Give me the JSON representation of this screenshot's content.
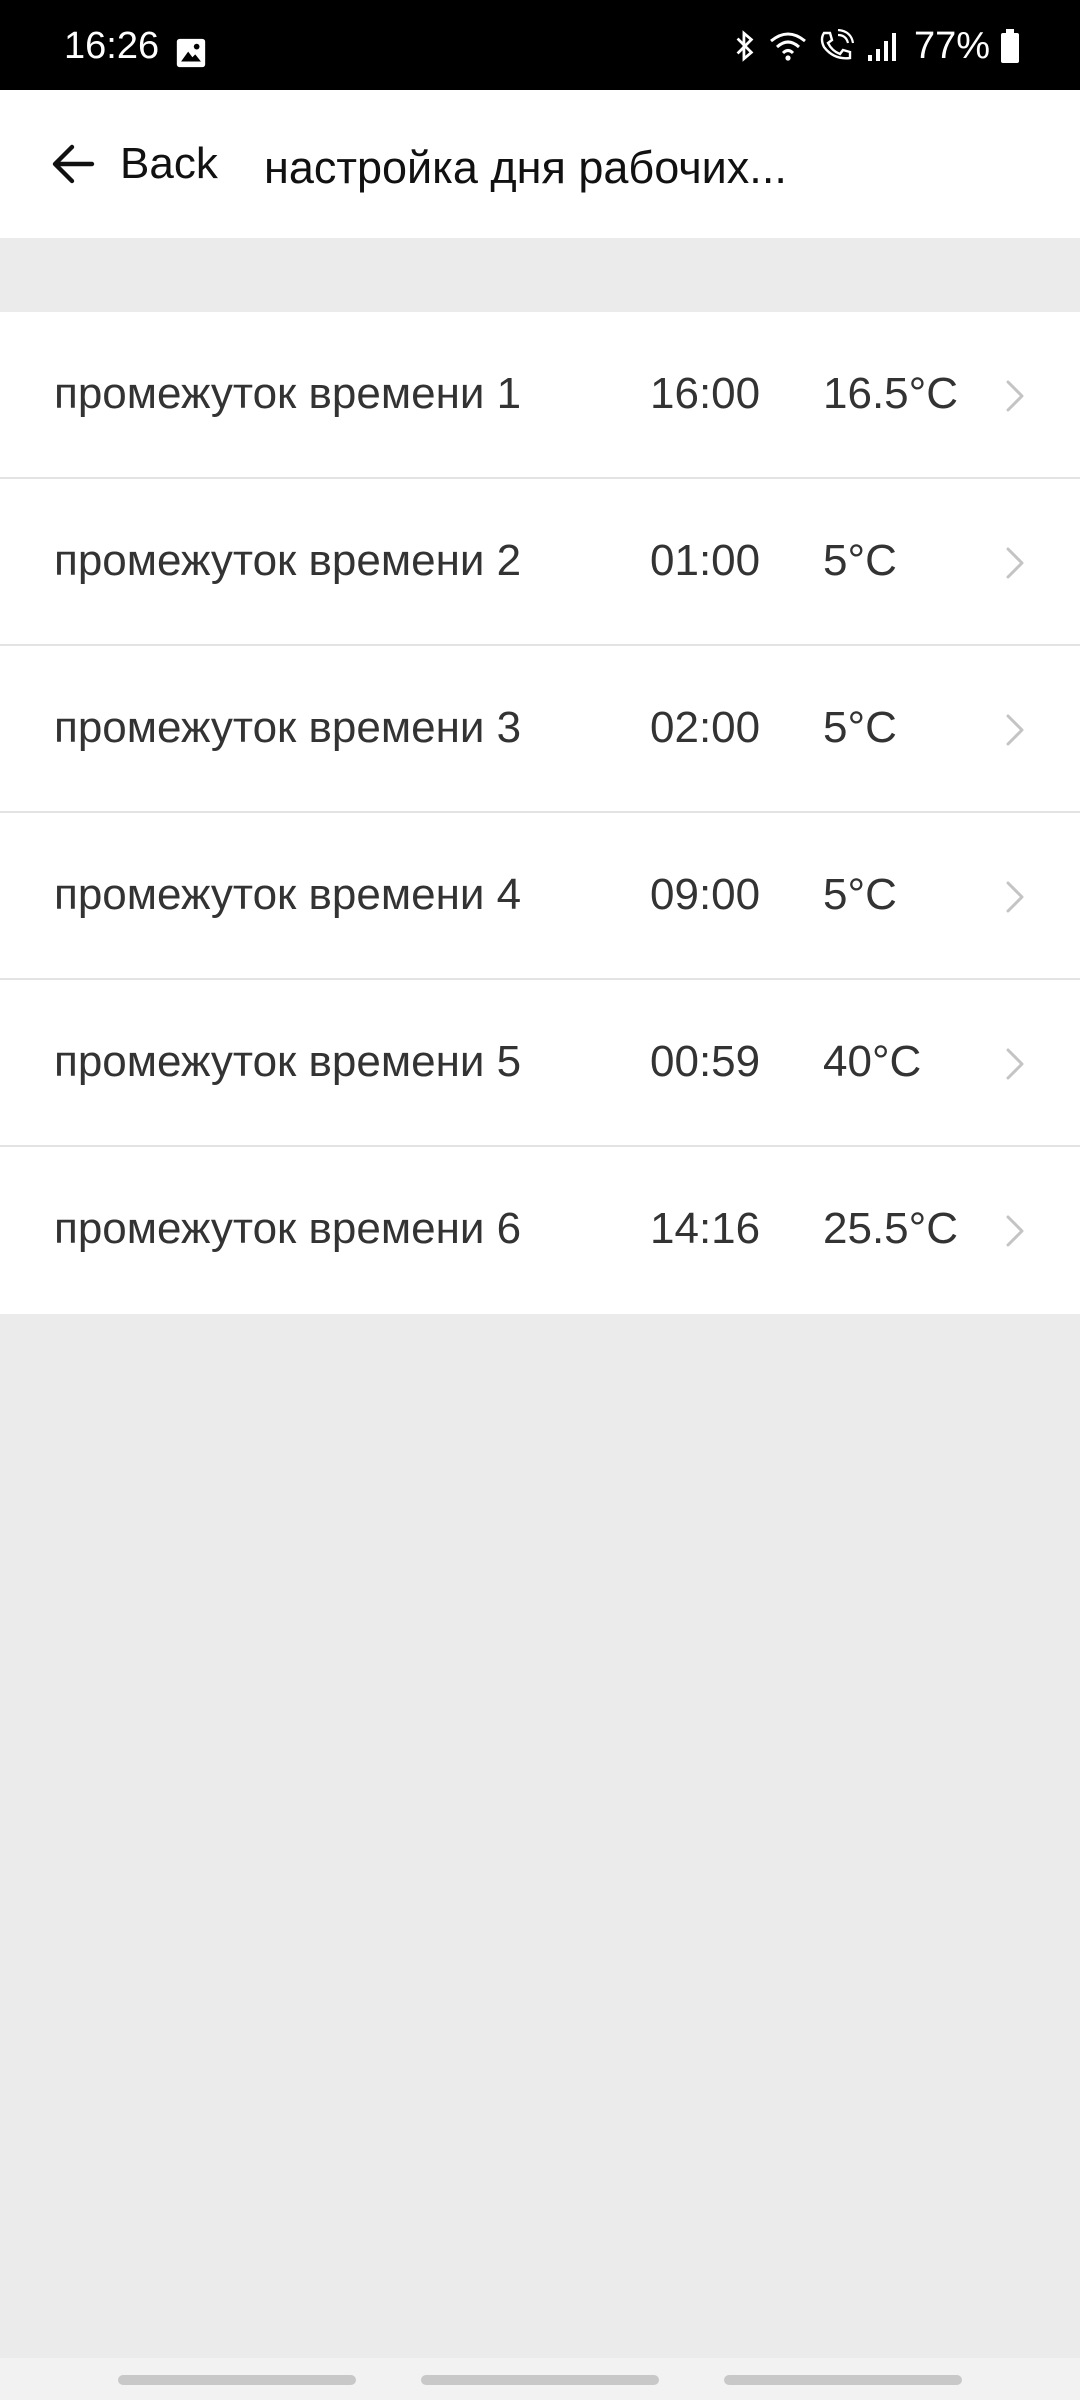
{
  "status_bar": {
    "time": "16:26",
    "battery": "77%",
    "icons": [
      "image-icon",
      "bluetooth-icon",
      "wifi-icon",
      "volte-call-icon",
      "signal-icon",
      "battery-icon"
    ]
  },
  "header": {
    "back_label": "Back",
    "title": "настройка дня рабочих..."
  },
  "periods": [
    {
      "label": "промежуток времени 1",
      "time": "16:00",
      "temp": "16.5°C"
    },
    {
      "label": "промежуток времени 2",
      "time": "01:00",
      "temp": "5°C"
    },
    {
      "label": "промежуток времени 3",
      "time": "02:00",
      "temp": "5°C"
    },
    {
      "label": "промежуток времени 4",
      "time": "09:00",
      "temp": "5°C"
    },
    {
      "label": "промежуток времени 5",
      "time": "00:59",
      "temp": "40°C"
    },
    {
      "label": "промежуток времени 6",
      "time": "14:16",
      "temp": "25.5°C"
    }
  ],
  "colors": {
    "background": "#ebebeb",
    "surface": "#ffffff",
    "text": "#333333",
    "chevron": "#c4c4c4"
  }
}
